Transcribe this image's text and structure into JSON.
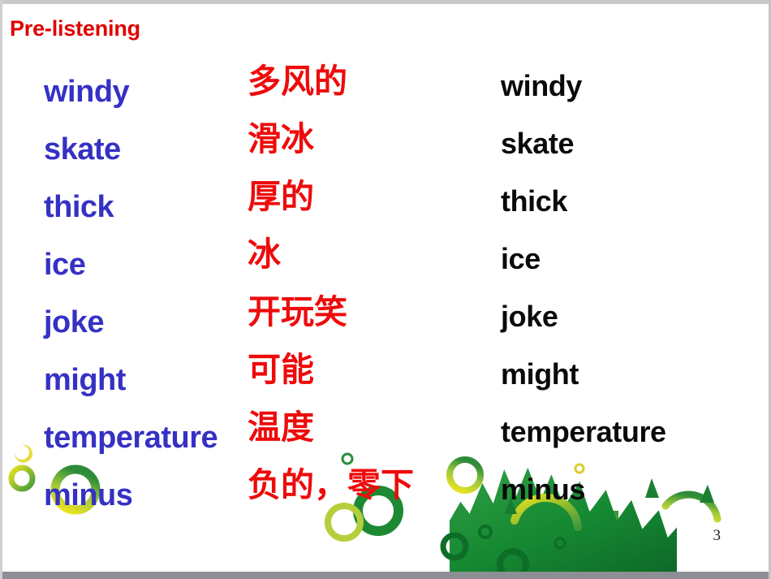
{
  "slide": {
    "title": "Pre-listening",
    "page_number": "3",
    "colors": {
      "title_red": "#e00000",
      "english_blue": "#3531c4",
      "chinese_red": "#ee0b0b",
      "english_black": "#0a0a0a",
      "leaf_green_dark": "#1b7a34",
      "leaf_green_light": "#8cc63f",
      "accent_yellow": "#e8d32a"
    }
  },
  "vocabulary": {
    "rows": [
      {
        "english_left": "windy",
        "chinese": "多风的",
        "english_right": "windy"
      },
      {
        "english_left": "skate",
        "chinese": "滑冰",
        "english_right": "skate"
      },
      {
        "english_left": "thick",
        "chinese": "厚的",
        "english_right": "thick"
      },
      {
        "english_left": "ice",
        "chinese": "冰",
        "english_right": "ice"
      },
      {
        "english_left": "joke",
        "chinese": "开玩笑",
        "english_right": "joke"
      },
      {
        "english_left": "might",
        "chinese": "可能",
        "english_right": "might"
      },
      {
        "english_left": "temperature",
        "chinese": "温度",
        "english_right": "temperature"
      },
      {
        "english_left": "minus",
        "chinese": "负的，零下",
        "english_right": "minus"
      }
    ]
  },
  "decoration": {
    "name": "green-maple-leaf-and-bubbles",
    "description": "green maple leaf silhouette with concentric ring bubbles along the bottom edge"
  }
}
